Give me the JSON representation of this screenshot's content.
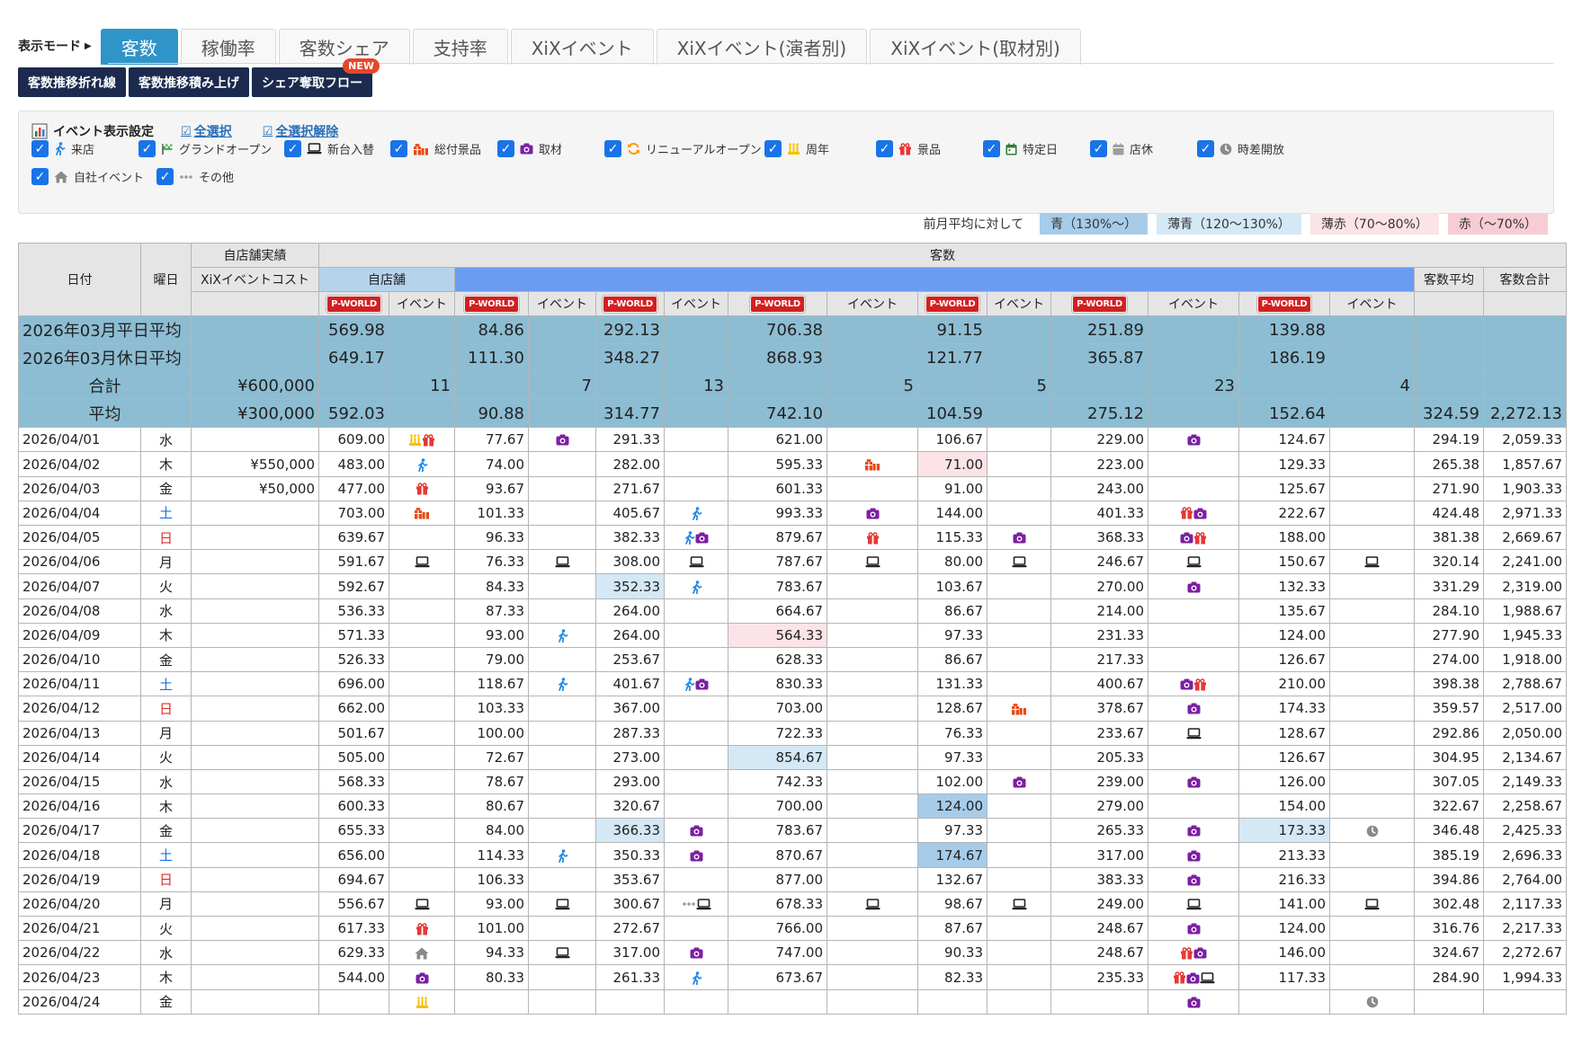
{
  "mode": {
    "label": "表示モード",
    "tabs": [
      {
        "label": "客数",
        "active": true
      },
      {
        "label": "稼働率",
        "active": false
      },
      {
        "label": "客数シェア",
        "active": false
      },
      {
        "label": "支持率",
        "active": false
      },
      {
        "label": "XiXイベント",
        "active": false
      },
      {
        "label": "XiXイベント(演者別)",
        "active": false
      },
      {
        "label": "XiXイベント(取材別)",
        "active": false
      }
    ]
  },
  "subbuttons": [
    {
      "label": "客数推移折れ線"
    },
    {
      "label": "客数推移積み上げ"
    },
    {
      "label": "シェア奪取フロー",
      "badge": "NEW"
    }
  ],
  "event_settings": {
    "title": "イベント表示設定",
    "select_all": "全選択",
    "deselect_all": "全選択解除",
    "items": [
      {
        "label": "来店",
        "icon": "walk-icon",
        "checked": true
      },
      {
        "label": "グランドオープン",
        "icon": "flag-icon",
        "checked": true
      },
      {
        "label": "新台入替",
        "icon": "laptop-icon",
        "checked": true
      },
      {
        "label": "総付景品",
        "icon": "gifts-icon",
        "checked": true
      },
      {
        "label": "取材",
        "icon": "camera-icon",
        "checked": true
      },
      {
        "label": "リニューアルオープン",
        "icon": "refresh-icon",
        "checked": true
      },
      {
        "label": "周年",
        "icon": "cake-icon",
        "checked": true
      },
      {
        "label": "景品",
        "icon": "gift-icon",
        "checked": true
      },
      {
        "label": "特定日",
        "icon": "calendar-icon",
        "checked": true
      },
      {
        "label": "店休",
        "icon": "calendar-gray-icon",
        "checked": true
      },
      {
        "label": "時差開放",
        "icon": "clock-icon",
        "checked": true
      },
      {
        "label": "自社イベント",
        "icon": "home-icon",
        "checked": true
      },
      {
        "label": "その他",
        "icon": "dots-icon",
        "checked": true
      }
    ]
  },
  "legend": {
    "label": "前月平均に対して",
    "items": [
      "青（130%〜）",
      "薄青（120〜130%）",
      "薄赤（70〜80%）",
      "赤（〜70%）"
    ]
  },
  "table": {
    "headers": {
      "date": "日付",
      "dow": "曜日",
      "own_results": "自店舗実績",
      "xix_cost": "XiXイベントコスト",
      "customers": "客数",
      "own_store": "自店舗",
      "avg": "客数平均",
      "total": "客数合計",
      "event": "イベント",
      "pworld": "P-WORLD"
    },
    "summary": [
      {
        "label": "2026年03月平日平均",
        "cost": "",
        "vals": [
          "569.98",
          "",
          "84.86",
          "",
          "292.13",
          "",
          "706.38",
          "",
          "91.15",
          "",
          "251.89",
          "",
          "139.88",
          ""
        ],
        "avg": "",
        "total": ""
      },
      {
        "label": "2026年03月休日平均",
        "cost": "",
        "vals": [
          "649.17",
          "",
          "111.30",
          "",
          "348.27",
          "",
          "868.93",
          "",
          "121.77",
          "",
          "365.87",
          "",
          "186.19",
          ""
        ],
        "avg": "",
        "total": ""
      },
      {
        "label": "合計",
        "cost": "¥600,000",
        "vals": [
          "",
          "11",
          "",
          "7",
          "",
          "13",
          "",
          "5",
          "",
          "5",
          "",
          "23",
          "",
          "4"
        ],
        "avg": "",
        "total": ""
      },
      {
        "label": "平均",
        "cost": "¥300,000",
        "vals": [
          "592.03",
          "",
          "90.88",
          "",
          "314.77",
          "",
          "742.10",
          "",
          "104.59",
          "",
          "275.12",
          "",
          "152.64",
          ""
        ],
        "avg": "324.59",
        "total": "2,272.13"
      }
    ],
    "rows": [
      {
        "date": "2026/04/01",
        "dow": "水",
        "cost": "",
        "vals": [
          "609.00",
          "77.67",
          "291.33",
          "621.00",
          "106.67",
          "229.00",
          "124.67"
        ],
        "ev": [
          [
            "cake-icon",
            "gift-icon"
          ],
          [
            "camera-icon"
          ],
          [],
          [],
          [],
          [
            "camera-icon"
          ],
          []
        ],
        "hl": {},
        "avg": "294.19",
        "total": "2,059.33"
      },
      {
        "date": "2026/04/02",
        "dow": "木",
        "cost": "¥550,000",
        "vals": [
          "483.00",
          "74.00",
          "282.00",
          "595.33",
          "71.00",
          "223.00",
          "129.33"
        ],
        "ev": [
          [
            "walk-icon"
          ],
          [],
          [],
          [
            "gifts-icon"
          ],
          [],
          [],
          []
        ],
        "hl": {
          "4": "hl-lred"
        },
        "avg": "265.38",
        "total": "1,857.67"
      },
      {
        "date": "2026/04/03",
        "dow": "金",
        "cost": "¥50,000",
        "vals": [
          "477.00",
          "93.67",
          "271.67",
          "601.33",
          "91.00",
          "243.00",
          "125.67"
        ],
        "ev": [
          [
            "gift-icon"
          ],
          [],
          [],
          [],
          [],
          [],
          []
        ],
        "hl": {},
        "avg": "271.90",
        "total": "1,903.33"
      },
      {
        "date": "2026/04/04",
        "dow": "土",
        "cost": "",
        "vals": [
          "703.00",
          "101.33",
          "405.67",
          "993.33",
          "144.00",
          "401.33",
          "222.67"
        ],
        "ev": [
          [
            "gifts-icon"
          ],
          [],
          [
            "walk-icon"
          ],
          [
            "camera-icon"
          ],
          [],
          [
            "gift-icon",
            "camera-icon"
          ],
          []
        ],
        "hl": {},
        "avg": "424.48",
        "total": "2,971.33"
      },
      {
        "date": "2026/04/05",
        "dow": "日",
        "cost": "",
        "vals": [
          "639.67",
          "96.33",
          "382.33",
          "879.67",
          "115.33",
          "368.33",
          "188.00"
        ],
        "ev": [
          [],
          [],
          [
            "walk-icon",
            "camera-icon"
          ],
          [
            "gift-icon"
          ],
          [
            "camera-icon"
          ],
          [
            "camera-icon",
            "gift-icon"
          ],
          []
        ],
        "hl": {},
        "avg": "381.38",
        "total": "2,669.67"
      },
      {
        "date": "2026/04/06",
        "dow": "月",
        "cost": "",
        "vals": [
          "591.67",
          "76.33",
          "308.00",
          "787.67",
          "80.00",
          "246.67",
          "150.67"
        ],
        "ev": [
          [
            "laptop-icon"
          ],
          [
            "laptop-icon"
          ],
          [
            "laptop-icon"
          ],
          [
            "laptop-icon"
          ],
          [
            "laptop-icon"
          ],
          [
            "laptop-icon"
          ],
          [
            "laptop-icon"
          ]
        ],
        "hl": {},
        "avg": "320.14",
        "total": "2,241.00"
      },
      {
        "date": "2026/04/07",
        "dow": "火",
        "cost": "",
        "vals": [
          "592.67",
          "84.33",
          "352.33",
          "783.67",
          "103.67",
          "270.00",
          "132.33"
        ],
        "ev": [
          [],
          [],
          [
            "walk-icon"
          ],
          [],
          [],
          [
            "camera-icon"
          ],
          []
        ],
        "hl": {
          "2": "hl-lblue"
        },
        "avg": "331.29",
        "total": "2,319.00"
      },
      {
        "date": "2026/04/08",
        "dow": "水",
        "cost": "",
        "vals": [
          "536.33",
          "87.33",
          "264.00",
          "664.67",
          "86.67",
          "214.00",
          "135.67"
        ],
        "ev": [
          [],
          [],
          [],
          [],
          [],
          [],
          []
        ],
        "hl": {},
        "avg": "284.10",
        "total": "1,988.67"
      },
      {
        "date": "2026/04/09",
        "dow": "木",
        "cost": "",
        "vals": [
          "571.33",
          "93.00",
          "264.00",
          "564.33",
          "97.33",
          "231.33",
          "124.00"
        ],
        "ev": [
          [],
          [
            "walk-icon"
          ],
          [],
          [],
          [],
          [],
          []
        ],
        "hl": {
          "3": "hl-lred"
        },
        "avg": "277.90",
        "total": "1,945.33"
      },
      {
        "date": "2026/04/10",
        "dow": "金",
        "cost": "",
        "vals": [
          "526.33",
          "79.00",
          "253.67",
          "628.33",
          "86.67",
          "217.33",
          "126.67"
        ],
        "ev": [
          [],
          [],
          [],
          [],
          [],
          [],
          []
        ],
        "hl": {},
        "avg": "274.00",
        "total": "1,918.00"
      },
      {
        "date": "2026/04/11",
        "dow": "土",
        "cost": "",
        "vals": [
          "696.00",
          "118.67",
          "401.67",
          "830.33",
          "131.33",
          "400.67",
          "210.00"
        ],
        "ev": [
          [],
          [
            "walk-icon"
          ],
          [
            "walk-icon",
            "camera-icon"
          ],
          [],
          [],
          [
            "camera-icon",
            "gift-icon"
          ],
          []
        ],
        "hl": {},
        "avg": "398.38",
        "total": "2,788.67"
      },
      {
        "date": "2026/04/12",
        "dow": "日",
        "cost": "",
        "vals": [
          "662.00",
          "103.33",
          "367.00",
          "703.00",
          "128.67",
          "378.67",
          "174.33"
        ],
        "ev": [
          [],
          [],
          [],
          [],
          [
            "gifts-icon"
          ],
          [
            "camera-icon"
          ],
          []
        ],
        "hl": {},
        "avg": "359.57",
        "total": "2,517.00"
      },
      {
        "date": "2026/04/13",
        "dow": "月",
        "cost": "",
        "vals": [
          "501.67",
          "100.00",
          "287.33",
          "722.33",
          "76.33",
          "233.67",
          "128.67"
        ],
        "ev": [
          [],
          [],
          [],
          [],
          [],
          [
            "laptop-icon"
          ],
          []
        ],
        "hl": {},
        "avg": "292.86",
        "total": "2,050.00"
      },
      {
        "date": "2026/04/14",
        "dow": "火",
        "cost": "",
        "vals": [
          "505.00",
          "72.67",
          "273.00",
          "854.67",
          "97.33",
          "205.33",
          "126.67"
        ],
        "ev": [
          [],
          [],
          [],
          [],
          [],
          [],
          []
        ],
        "hl": {
          "3": "hl-lblue"
        },
        "avg": "304.95",
        "total": "2,134.67"
      },
      {
        "date": "2026/04/15",
        "dow": "水",
        "cost": "",
        "vals": [
          "568.33",
          "78.67",
          "293.00",
          "742.33",
          "102.00",
          "239.00",
          "126.00"
        ],
        "ev": [
          [],
          [],
          [],
          [],
          [
            "camera-icon"
          ],
          [
            "camera-icon"
          ],
          []
        ],
        "hl": {},
        "avg": "307.05",
        "total": "2,149.33"
      },
      {
        "date": "2026/04/16",
        "dow": "木",
        "cost": "",
        "vals": [
          "600.33",
          "80.67",
          "320.67",
          "700.00",
          "124.00",
          "279.00",
          "154.00"
        ],
        "ev": [
          [],
          [],
          [],
          [],
          [],
          [],
          []
        ],
        "hl": {
          "4": "hl-blue"
        },
        "avg": "322.67",
        "total": "2,258.67"
      },
      {
        "date": "2026/04/17",
        "dow": "金",
        "cost": "",
        "vals": [
          "655.33",
          "84.00",
          "366.33",
          "783.67",
          "97.33",
          "265.33",
          "173.33"
        ],
        "ev": [
          [],
          [],
          [
            "camera-icon"
          ],
          [],
          [],
          [
            "camera-icon"
          ],
          [
            "clock-icon"
          ]
        ],
        "hl": {
          "2": "hl-lblue",
          "6": "hl-lblue"
        },
        "avg": "346.48",
        "total": "2,425.33"
      },
      {
        "date": "2026/04/18",
        "dow": "土",
        "cost": "",
        "vals": [
          "656.00",
          "114.33",
          "350.33",
          "870.67",
          "174.67",
          "317.00",
          "213.33"
        ],
        "ev": [
          [],
          [
            "walk-icon"
          ],
          [
            "camera-icon"
          ],
          [],
          [],
          [
            "camera-icon"
          ],
          []
        ],
        "hl": {
          "4": "hl-blue"
        },
        "avg": "385.19",
        "total": "2,696.33"
      },
      {
        "date": "2026/04/19",
        "dow": "日",
        "cost": "",
        "vals": [
          "694.67",
          "106.33",
          "353.67",
          "877.00",
          "132.67",
          "383.33",
          "216.33"
        ],
        "ev": [
          [],
          [],
          [],
          [],
          [],
          [
            "camera-icon"
          ],
          []
        ],
        "hl": {},
        "avg": "394.86",
        "total": "2,764.00"
      },
      {
        "date": "2026/04/20",
        "dow": "月",
        "cost": "",
        "vals": [
          "556.67",
          "93.00",
          "300.67",
          "678.33",
          "98.67",
          "249.00",
          "141.00"
        ],
        "ev": [
          [
            "laptop-icon"
          ],
          [
            "laptop-icon"
          ],
          [
            "dots-icon",
            "laptop-icon"
          ],
          [
            "laptop-icon"
          ],
          [
            "laptop-icon"
          ],
          [
            "laptop-icon"
          ],
          [
            "laptop-icon"
          ]
        ],
        "hl": {},
        "avg": "302.48",
        "total": "2,117.33"
      },
      {
        "date": "2026/04/21",
        "dow": "火",
        "cost": "",
        "vals": [
          "617.33",
          "101.00",
          "272.67",
          "766.00",
          "87.67",
          "248.67",
          "124.00"
        ],
        "ev": [
          [
            "gift-icon"
          ],
          [],
          [],
          [],
          [],
          [
            "camera-icon"
          ],
          []
        ],
        "hl": {},
        "avg": "316.76",
        "total": "2,217.33"
      },
      {
        "date": "2026/04/22",
        "dow": "水",
        "cost": "",
        "vals": [
          "629.33",
          "94.33",
          "317.00",
          "747.00",
          "90.33",
          "248.67",
          "146.00"
        ],
        "ev": [
          [
            "home-icon"
          ],
          [
            "laptop-icon"
          ],
          [
            "camera-icon"
          ],
          [],
          [],
          [
            "gift-icon",
            "camera-icon"
          ],
          []
        ],
        "hl": {},
        "avg": "324.67",
        "total": "2,272.67"
      },
      {
        "date": "2026/04/23",
        "dow": "木",
        "cost": "",
        "vals": [
          "544.00",
          "80.33",
          "261.33",
          "673.67",
          "82.33",
          "235.33",
          "117.33"
        ],
        "ev": [
          [
            "camera-icon"
          ],
          [],
          [
            "walk-icon"
          ],
          [],
          [],
          [
            "gift-icon",
            "camera-icon",
            "laptop-icon"
          ],
          []
        ],
        "hl": {},
        "avg": "284.90",
        "total": "1,994.33"
      },
      {
        "date": "2026/04/24",
        "dow": "金",
        "cost": "",
        "vals": [
          "",
          "",
          "",
          "",
          "",
          "",
          ""
        ],
        "ev": [
          [
            "cake-icon"
          ],
          [],
          [],
          [],
          [],
          [
            "camera-icon"
          ],
          [
            "clock-icon"
          ]
        ],
        "hl": {},
        "avg": "",
        "total": ""
      }
    ]
  },
  "colors": {
    "tab_active": "#2f94c8",
    "sub_button": "#1b2a4e",
    "summary_bg": "#8cbdd3",
    "highlight_blue": "#a6ccea",
    "highlight_light_blue": "#d4e8f6",
    "highlight_light_red": "#fbe3e7",
    "highlight_red": "#f8ccd4",
    "saturday": "#1a73e8",
    "sunday": "#d9302a"
  }
}
